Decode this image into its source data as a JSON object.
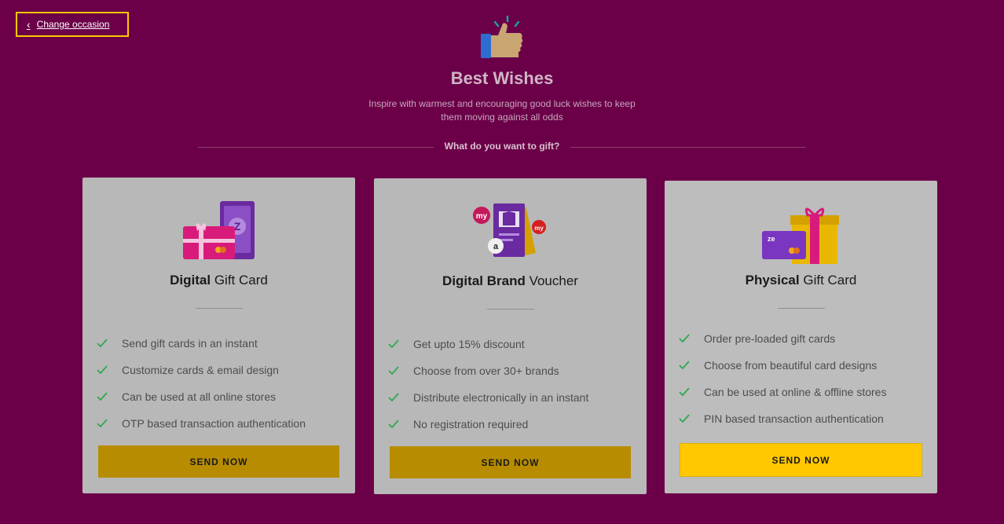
{
  "nav": {
    "back_label": "Change occasion"
  },
  "occasion": {
    "icon": "thumbs-up-icon",
    "title": "Best Wishes",
    "description": "Inspire with warmest and encouraging good luck wishes to keep them moving against all odds"
  },
  "question": "What do you want to gift?",
  "colors": {
    "background": "#6b0048",
    "accent": "#ffc800",
    "check": "#2fa84f"
  },
  "cards": [
    {
      "title_bold": "Digital",
      "title_rest": " Gift Card",
      "features": [
        "Send gift cards in an instant",
        "Customize cards & email design",
        "Can be used at all online stores",
        "OTP based transaction authentication"
      ],
      "button": "SEND NOW"
    },
    {
      "title_bold": "Digital Brand",
      "title_rest": " Voucher",
      "features": [
        "Get upto 15% discount",
        "Choose from over 30+ brands",
        "Distribute electronically in an instant",
        "No registration required"
      ],
      "button": "SEND NOW"
    },
    {
      "title_bold": "Physical",
      "title_rest": " Gift Card",
      "features": [
        "Order pre-loaded gift cards",
        "Choose from beautiful card designs",
        "Can be used at online & offline stores",
        "PIN based transaction authentication"
      ],
      "button": "SEND NOW"
    }
  ]
}
